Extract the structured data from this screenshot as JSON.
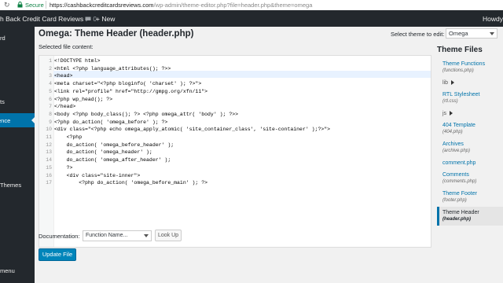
{
  "browser": {
    "secure_label": "Secure",
    "url_host": "https://cashbackcreditcardsreviews.com",
    "url_path": "/wp-admin/theme-editor.php?file=header.php&theme=omega"
  },
  "adminbar": {
    "site_name": "h Back Credit Card Reviews",
    "comments_count": "0",
    "new_label": "+ New",
    "howdy": "Howdy"
  },
  "sidebar": {
    "items": [
      "rd",
      "ts",
      "ence",
      "Themes",
      "menu"
    ]
  },
  "main": {
    "title": "Omega: Theme Header (header.php)",
    "select_theme_label": "Select theme to edit:",
    "selected_theme": "Omega",
    "file_content_label": "Selected file content:"
  },
  "editor": {
    "lines": [
      {
        "n": "1",
        "code": "<!DOCTYPE html>"
      },
      {
        "n": "2",
        "code": "<html <?php language_attributes(); ?>>"
      },
      {
        "n": "3",
        "code": "<head>"
      },
      {
        "n": "4",
        "code": "<meta charset=\"<?php bloginfo( 'charset' ); ?>\">"
      },
      {
        "n": "5",
        "code": "<link rel=\"profile\" href=\"http://gmpg.org/xfn/11\">"
      },
      {
        "n": "6",
        "code": "<?php wp_head(); ?>"
      },
      {
        "n": "7",
        "code": "</head>"
      },
      {
        "n": "8",
        "code": "<body <?php body_class(); ?> <?php omega_attr( 'body' ); ?>>"
      },
      {
        "n": "9",
        "code": "<?php do_action( 'omega_before' ); ?>"
      },
      {
        "n": "10",
        "code": "<div class=\"<?php echo omega_apply_atomic( 'site_container_class', 'site-container' );?>\">"
      },
      {
        "n": "11",
        "code": "    <?php"
      },
      {
        "n": "12",
        "code": "    do_action( 'omega_before_header' );"
      },
      {
        "n": "13",
        "code": "    do_action( 'omega_header' );"
      },
      {
        "n": "14",
        "code": "    do_action( 'omega_after_header' );"
      },
      {
        "n": "15",
        "code": "    ?>"
      },
      {
        "n": "16",
        "code": "    <div class=\"site-inner\">"
      },
      {
        "n": "17",
        "code": "        <?php do_action( 'omega_before_main' ); ?>"
      }
    ]
  },
  "theme_files": {
    "heading": "Theme Files",
    "items": [
      {
        "label": "Theme Functions",
        "file": "(functions.php)"
      },
      {
        "label": "lib",
        "file": ""
      },
      {
        "label": "RTL Stylesheet",
        "file": "(rtl.css)"
      },
      {
        "label": "js",
        "file": ""
      },
      {
        "label": "404 Template",
        "file": "(404.php)"
      },
      {
        "label": "Archives",
        "file": "(archive.php)"
      },
      {
        "label": "comment.php",
        "file": ""
      },
      {
        "label": "Comments",
        "file": "(comments.php)"
      },
      {
        "label": "Theme Footer",
        "file": "(footer.php)"
      },
      {
        "label": "Theme Header",
        "file": "(header.php)"
      }
    ]
  },
  "footer": {
    "documentation_label": "Documentation:",
    "function_placeholder": "Function Name...",
    "lookup_label": "Look Up",
    "update_label": "Update File"
  },
  "colors": {
    "admin_bar": "#23282d",
    "accent": "#0073aa",
    "button": "#0085ba"
  }
}
